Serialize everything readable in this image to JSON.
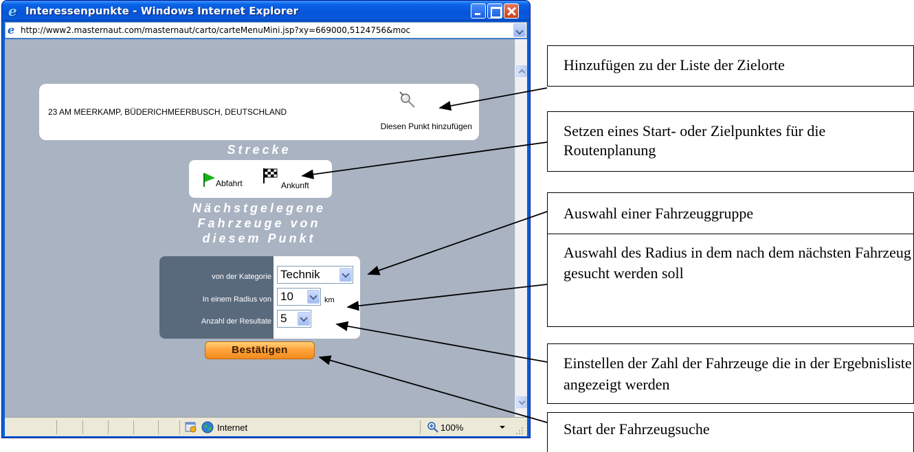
{
  "window": {
    "title": "Interessenpunkte - Windows Internet Explorer",
    "url": "http://www2.masternaut.com/masternaut/carto/carteMenuMini.jsp?xy=669000,5124756&moc"
  },
  "address_card": {
    "address": "23 AM MEERKAMP, BÜDERICHMEERBUSCH, DEUTSCHLAND",
    "add_point_label": "Diesen Punkt hinzufügen"
  },
  "route": {
    "title": "Strecke",
    "departure_label": "Abfahrt",
    "arrival_label": "Ankunft"
  },
  "nearest": {
    "title_lines": [
      "Nächstgelegene",
      "Fahrzeuge von",
      "diesem Punkt"
    ],
    "category_label": "von der Kategorie",
    "category_value": "Technik",
    "radius_label": "In einem Radius von",
    "radius_value": "10",
    "radius_unit": "km",
    "results_label": "Anzahl der Resultate",
    "results_value": "5",
    "confirm_label": "Bestätigen"
  },
  "statusbar": {
    "zone": "Internet",
    "zoom": "100%"
  },
  "callouts": [
    "Hinzufügen zu der Liste der Zielorte",
    "Setzen eines Start- oder Zielpunktes für die Routenplanung",
    "Auswahl einer Fahrzeuggruppe",
    "Auswahl des Radius in dem nach dem nächsten Fahrzeug gesucht werden soll",
    "Einstellen der Zahl der Fahrzeuge die in der Ergebnisliste angezeigt werden",
    "Start der Fahrzeugsuche"
  ],
  "colors": {
    "titlebar": "#0553d8",
    "content_bg": "#a9b3c2",
    "form_label_bg": "#5a6a7d",
    "confirm_button": "#ffa43c",
    "flag_green": "#17b317"
  }
}
